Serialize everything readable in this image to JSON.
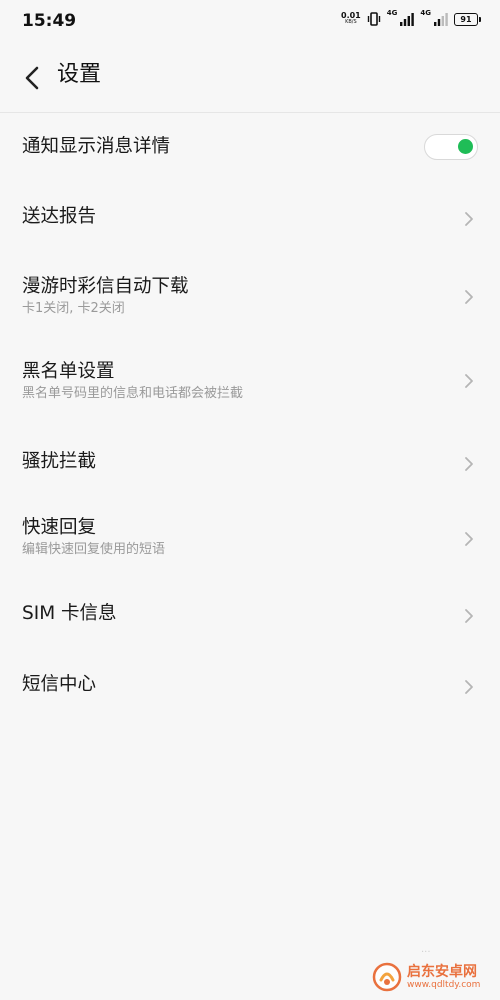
{
  "status_bar": {
    "time": "15:49",
    "net_speed_value": "0.01",
    "net_speed_unit": "KB/S",
    "sim1_label": "4G",
    "sim2_label": "4G",
    "battery": "91",
    "icons": [
      "vibrate-icon",
      "signal-icon",
      "signal-icon",
      "battery-icon"
    ]
  },
  "header": {
    "back_icon": "chevron-left-icon",
    "title": "设置"
  },
  "settings": {
    "items": [
      {
        "title": "通知显示消息详情",
        "subtitle": "",
        "control": "toggle",
        "toggle_on": true
      },
      {
        "title": "送达报告",
        "subtitle": "",
        "control": "chevron"
      },
      {
        "title": "漫游时彩信自动下载",
        "subtitle": "卡1关闭, 卡2关闭",
        "control": "chevron"
      },
      {
        "title": "黑名单设置",
        "subtitle": "黑名单号码里的信息和电话都会被拦截",
        "control": "chevron"
      },
      {
        "title": "骚扰拦截",
        "subtitle": "",
        "control": "chevron"
      },
      {
        "title": "快速回复",
        "subtitle": "编辑快速回复使用的短语",
        "control": "chevron"
      },
      {
        "title": "SIM 卡信息",
        "subtitle": "",
        "control": "chevron"
      },
      {
        "title": "短信中心",
        "subtitle": "",
        "control": "chevron"
      }
    ]
  },
  "colors": {
    "toggle_on": "#1fbd57",
    "background": "#f7f7f7",
    "subtitle": "#9a9a9a",
    "watermark": "#e8632b"
  },
  "watermark": {
    "name": "启东安卓网",
    "url": "www.qdltdy.com",
    "faint": "..."
  }
}
